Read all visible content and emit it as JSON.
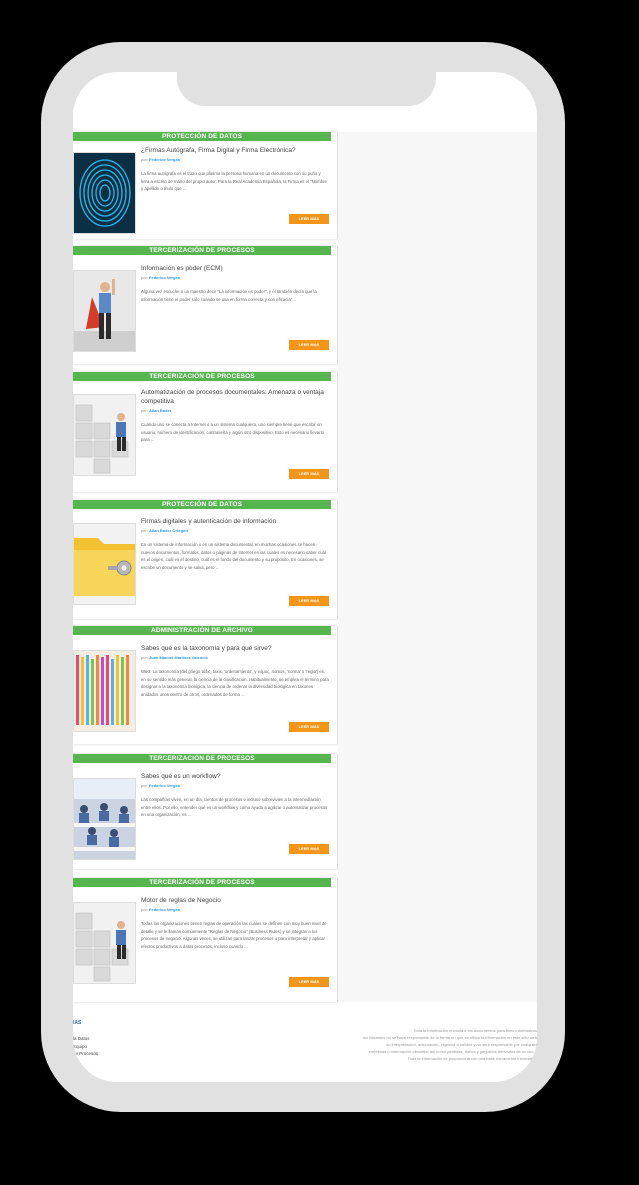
{
  "read_more_label": "LEER MÁS",
  "by_prefix": "por:",
  "accent_colors": {
    "category_bar": "#56b54f",
    "read_more": "#f39517",
    "author": "#2e9be3"
  },
  "posts": [
    {
      "category": "PROTECCIÓN DE DATOS",
      "title": "¿Firmas Autógrafa, Firma Digital y Firma Electrónica?",
      "author": "Federico Vergas",
      "excerpt": "La firma autógrafa es el trazo que plasma la persona humana en un documento con su puño y letra a escrito de mano del propio autor. Para la Real Academia Española, la Firma es el \"Nombre y apellido o título que ...",
      "image": "fingerprint-photo"
    },
    {
      "category": "TERCERIZACIÓN DE PROCESOS",
      "title": "Información es poder (ECM)",
      "author": "Federico Vergas",
      "excerpt": "Alguna vez escuche a un maestro decir \"La información es poder\", y  él también decía que la información tiene el poder sólo cuando se usa en forma correcta y con eficacia\"...",
      "image": "superhero-photo"
    },
    {
      "category": "TERCERIZACIÓN DE PROCESOS",
      "title": "Automatización de procesos documentales: Amenaza o ventaja competitiva",
      "author": "Allan Bader",
      "excerpt": "Cuando uno se conecta a Internet o a un sistema cualquiera, uno siempre tiene que escribir un usuario, número de identificación, contraseña y algún otro dispositivo. Esto es necesario llevarlo para ...",
      "image": "puzzle-photo"
    },
    {
      "category": "PROTECCIÓN DE DATOS",
      "title": "Firmas digitales y autenticación de información",
      "author": "Allan Bader Ortegón",
      "excerpt": "En un sistema de información o en un sistema documental, en muchas ocasiones se hacen nuevos documentos, formatos, datos o páginas de Internet en las cuales es necesario saber cuál es el origen, cuál es el destino, cuál es el fondo del documento y su propósito. En ocasiones, se escribe un documento y se salva, pero ...",
      "image": "folder-key-photo"
    },
    {
      "category": "ADMINISTRACIÓN DE ARCHIVO",
      "title": "Sabes qué es la taxonomía y para qué sirve?",
      "author": "Juan Manuel Martínez Valencia",
      "excerpt": "WIKI: La taxonomía (del griego τάξις, taxis, 'ordenamiento', y νόμος, nomos, 'norma' o 'regla') es, en su sentido más general, la ciencia de la clasificación. Habitualmente, se emplea el término para designar a la taxonomía biológica, la ciencia de ordenar la diversidad biológica en taxones anidados unos dentro de otros, ordenados de forma ...",
      "image": "files-photo"
    },
    {
      "category": "TERCERIZACIÓN DE PROCESOS",
      "title": "Sabes qué es un workflow?",
      "author": "Federico Vergas",
      "excerpt": "Las compañías viven, en un día, cientos de procesos e incluso sobrevivien a la intermediación entre ellos. Por ello, entender qué es un workflow y como ayuda a agilizar o automatizar procesos en una organización, es ...",
      "image": "office-photo"
    },
    {
      "category": "TERCERIZACIÓN DE PROCESOS",
      "title": "Motor de reglas de Negocio",
      "author": "Federico Vergas",
      "excerpt": "Todas las organizaciones tienen reglas de operación las cuales se definen con muy buen nivel de detalle y se le llaman comúnmente \"Reglas de Negocio\" (Business Rules) y se integran a los procesos de negocio. Algunas veces, se utilizan para lanzar procesos o para interpretar y aplicar efectos productivos a datos procesos, incluso cuando ...",
      "image": "puzzle-photo"
    }
  ],
  "footer": {
    "brand": "IAS",
    "links": [
      "la Datos",
      "Equipo",
      "de Procesos"
    ],
    "legal": [
      "Toda la información enviada a los documentos para fines informativos",
      "Ion Misantos  no se hace responsable de la forma en que se utilice la información en este sitio web",
      "su interpretación, adecuación, vigencia o validez y no será responsable por cualquier",
      "empresas o información obsoleta: así como pérdidas, daños y perjuicios derivados de su uso o",
      "Toda la información se proporciona con una base meramente informativa"
    ]
  }
}
